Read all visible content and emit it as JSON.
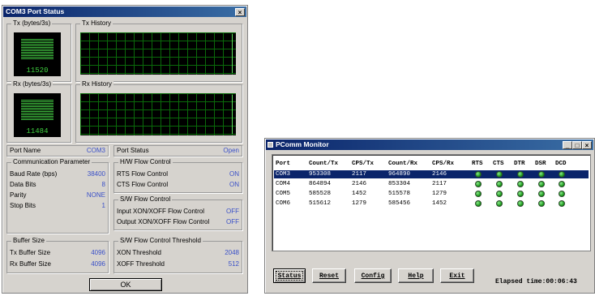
{
  "status_window": {
    "title": "COM3 Port Status",
    "close_glyph": "×",
    "tx_meter": {
      "label": "Tx (bytes/3s)",
      "value": "11520"
    },
    "tx_history_label": "Tx History",
    "rx_meter": {
      "label": "Rx (bytes/3s)",
      "value": "11484"
    },
    "rx_history_label": "Rx History",
    "port_name": {
      "label": "Port Name",
      "value": "COM3"
    },
    "port_status": {
      "label": "Port Status",
      "value": "Open"
    },
    "comm": {
      "label": "Communication Parameter",
      "rows": [
        {
          "label": "Baud Rate (bps)",
          "value": "38400"
        },
        {
          "label": "Data Bits",
          "value": "8"
        },
        {
          "label": "Parity",
          "value": "NONE"
        },
        {
          "label": "Stop Bits",
          "value": "1"
        }
      ]
    },
    "hw_flow": {
      "label": "H/W Flow Control",
      "rows": [
        {
          "label": "RTS Flow Control",
          "value": "ON"
        },
        {
          "label": "CTS Flow Control",
          "value": "ON"
        }
      ]
    },
    "sw_flow": {
      "label": "S/W Flow Control",
      "rows": [
        {
          "label": "Input XON/XOFF Flow Control",
          "value": "OFF"
        },
        {
          "label": "Output XON/XOFF Flow Control",
          "value": "OFF"
        }
      ]
    },
    "buffer": {
      "label": "Buffer Size",
      "rows": [
        {
          "label": "Tx Buffer Size",
          "value": "4096"
        },
        {
          "label": "Rx Buffer Size",
          "value": "4096"
        }
      ]
    },
    "sw_threshold": {
      "label": "S/W Flow Control Threshold",
      "rows": [
        {
          "label": "XON Threshold",
          "value": "2048"
        },
        {
          "label": "XOFF Threshold",
          "value": "512"
        }
      ]
    },
    "ok_label": "OK"
  },
  "monitor_window": {
    "title": "PComm Monitor",
    "controls": {
      "minimize": "_",
      "maximize": "□",
      "close": "×"
    },
    "columns": [
      "Port",
      "Count/Tx",
      "CPS/Tx",
      "Count/Rx",
      "CPS/Rx",
      "RTS",
      "CTS",
      "DTR",
      "DSR",
      "DCD"
    ],
    "rows": [
      {
        "port": "COM3",
        "count_tx": "953308",
        "cps_tx": "2117",
        "count_rx": "964890",
        "cps_rx": "2146",
        "selected": true
      },
      {
        "port": "COM4",
        "count_tx": "864894",
        "cps_tx": "2146",
        "count_rx": "853304",
        "cps_rx": "2117",
        "selected": false
      },
      {
        "port": "COM5",
        "count_tx": "585528",
        "cps_tx": "1452",
        "count_rx": "515578",
        "cps_rx": "1279",
        "selected": false
      },
      {
        "port": "COM6",
        "count_tx": "515612",
        "cps_tx": "1279",
        "count_rx": "585456",
        "cps_rx": "1452",
        "selected": false
      }
    ],
    "led_color": "#2aaa2a",
    "buttons": [
      "Status",
      "Reset",
      "Config",
      "Help",
      "Exit"
    ],
    "elapsed": "Elapsed time:00:06:43"
  }
}
